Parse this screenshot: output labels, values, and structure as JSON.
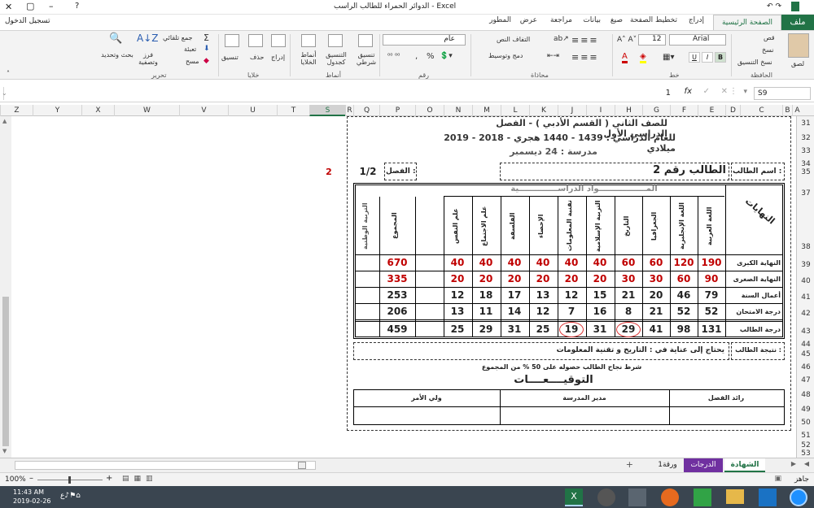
{
  "window": {
    "title": "الدوائر الحمراء للطالب الراسب - Excel",
    "signin": "تسجيل الدخول",
    "question": "?"
  },
  "tabs": [
    "ملف",
    "الصفحة الرئيسية",
    "إدراج",
    "تخطيط الصفحة",
    "صيغ",
    "بيانات",
    "مراجعة",
    "عرض",
    "المطور"
  ],
  "ribbon": {
    "clipboard": {
      "label": "الحافظة",
      "paste": "لصق",
      "cut": "قص",
      "copy": "نسخ",
      "format_painter": "نسخ التنسيق"
    },
    "font": {
      "label": "خط",
      "name": "Arial",
      "size": "12",
      "bold": "B",
      "italic": "I",
      "underline": "U"
    },
    "alignment": {
      "label": "محاذاة",
      "wrap": "التفاف النص",
      "merge": "دمج وتوسيط"
    },
    "number": {
      "label": "رقم",
      "format": "عام",
      "percent": "%",
      "comma": ","
    },
    "styles": {
      "label": "أنماط",
      "conditional": "تنسيق شرطي",
      "table": "التنسيق كجدول",
      "cell": "أنماط الخلايا"
    },
    "cells": {
      "label": "خلايا",
      "insert": "إدراج",
      "delete": "حذف",
      "format": "تنسيق"
    },
    "editing": {
      "label": "تحرير",
      "autosum": "جمع تلقائي",
      "fill": "تعبئة",
      "clear": "مسح",
      "sort": "فرز وتصفية",
      "find": "بحث وتحديد"
    }
  },
  "formula_bar": {
    "name_box": "S9",
    "fx": "fx",
    "value": "1"
  },
  "columns": [
    "Z",
    "Y",
    "X",
    "W",
    "V",
    "U",
    "T",
    "S",
    "R",
    "Q",
    "P",
    "O",
    "N",
    "M",
    "L",
    "K",
    "J",
    "I",
    "H",
    "G",
    "F",
    "E",
    "D",
    "C",
    "B",
    "A"
  ],
  "rows": [
    "31",
    "32",
    "33",
    "34",
    "35",
    "37",
    "38",
    "39",
    "40",
    "41",
    "42",
    "43",
    "44",
    "45",
    "46",
    "47",
    "48",
    "49",
    "50",
    "51",
    "52",
    "53"
  ],
  "sheet": {
    "header1": "للصف الثاني ( القسم الأدبي ) - الفصل الدراسي الأول",
    "header2": "للعام الدراسي : 1439 - 1440 هجري - 2018 - 2019 ميلادي",
    "header3": "مدرسة : 24 ديسمبر",
    "student_label": "اسم الطالب :",
    "student_name": "الطالب رقم 2",
    "class_label": "الفصل :",
    "class_value": "1/2",
    "aside_number": "2",
    "subjects_title": "المـــــــــــــــــواد الدراســــــــــــــية",
    "endings_label": "النهايات",
    "subjects": [
      "اللغة العربية",
      "اللغة الإنجليزية",
      "الجغرافيا",
      "التاريخ",
      "التربية الإسلامية",
      "تقنية المعلومات",
      "الإحصاء",
      "الفلسفة",
      "علم الاجتماع",
      "علم النفس"
    ],
    "total_label": "المجموع",
    "national_label": "التربية الوطنية",
    "row_labels": [
      "النهاية الكبرى",
      "النهاية الصغرى",
      "أعمال السنة",
      "درجة الامتحان",
      "درجة الطالب"
    ],
    "max": [
      "190",
      "120",
      "60",
      "60",
      "40",
      "40",
      "40",
      "40",
      "40",
      "40"
    ],
    "min": [
      "90",
      "60",
      "30",
      "30",
      "20",
      "20",
      "20",
      "20",
      "20",
      "20"
    ],
    "year": [
      "79",
      "46",
      "20",
      "21",
      "15",
      "12",
      "13",
      "17",
      "18",
      "12"
    ],
    "exam": [
      "52",
      "52",
      "21",
      "8",
      "16",
      "7",
      "12",
      "14",
      "11",
      "13"
    ],
    "student": [
      "131",
      "98",
      "41",
      "29",
      "31",
      "19",
      "25",
      "31",
      "29",
      "25"
    ],
    "totals": [
      "670",
      "335",
      "253",
      "206",
      "459"
    ],
    "result_label": "نتيجة الطالب :",
    "result_value": "يحتاج إلى عناية في : التاريخ و تقنية المعلومات",
    "condition": "شرط نجاح الطالب حصوله على 50 % من المجموع",
    "signatures_title": "التوقيــــعــــات",
    "sig_leader": "رائد الفصل",
    "sig_director": "مدير المدرسة",
    "sig_guardian": "ولي الأمر"
  },
  "sheet_tabs": {
    "tab1": "الشهادة",
    "tab2": "الدرجات",
    "tab3": "ورقة1",
    "add": "+"
  },
  "status": {
    "ready": "جاهز",
    "zoom": "100%"
  },
  "taskbar": {
    "time": "11:43 AM",
    "date": "2019-02-26"
  },
  "colors": {
    "excel_green": "#217346",
    "red": "#c00000",
    "sheet_tab_purple": "#7030a0"
  }
}
